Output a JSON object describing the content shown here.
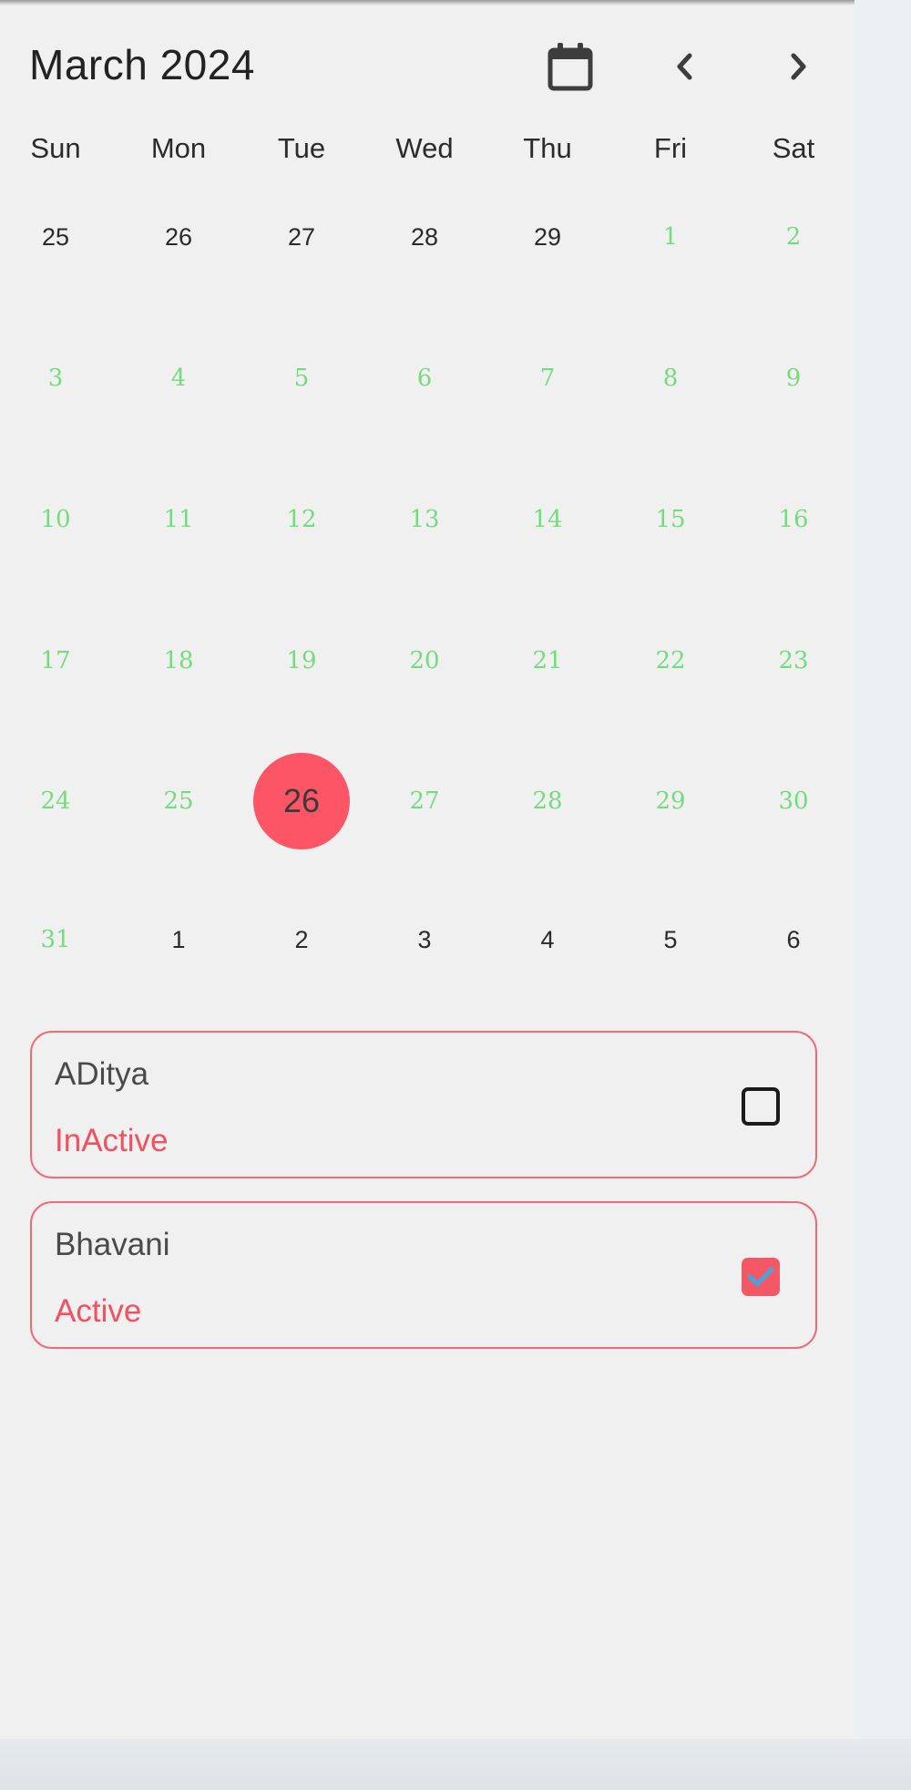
{
  "header": {
    "title": "March 2024",
    "calendar_icon": "calendar-icon",
    "prev_icon": "chevron-left-icon",
    "next_icon": "chevron-right-icon"
  },
  "weekdays": [
    "Sun",
    "Mon",
    "Tue",
    "Wed",
    "Thu",
    "Fri",
    "Sat"
  ],
  "weeks": [
    [
      "25",
      "26",
      "27",
      "28",
      "29",
      "1",
      "2"
    ],
    [
      "3",
      "4",
      "5",
      "6",
      "7",
      "8",
      "9"
    ],
    [
      "10",
      "11",
      "12",
      "13",
      "14",
      "15",
      "16"
    ],
    [
      "17",
      "18",
      "19",
      "20",
      "21",
      "22",
      "23"
    ],
    [
      "24",
      "25",
      "26",
      "27",
      "28",
      "29",
      "30"
    ],
    [
      "31",
      "1",
      "2",
      "3",
      "4",
      "5",
      "6"
    ]
  ],
  "selected_day": "26",
  "colors": {
    "current_month_day": "#74dd7b",
    "adjacent_month_day": "#2a2a2a",
    "selected_circle": "#fc5565",
    "card_border": "#f26a76",
    "status_text": "#f2525f",
    "check_mark": "#4aa3d8"
  },
  "members": [
    {
      "name": "ADitya",
      "status": "InActive",
      "checked": false
    },
    {
      "name": "Bhavani",
      "status": "Active",
      "checked": true
    }
  ]
}
